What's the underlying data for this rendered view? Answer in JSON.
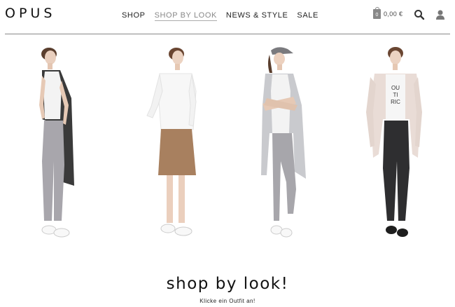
{
  "brand": {
    "logo": "OPUS"
  },
  "nav": {
    "items": [
      {
        "label": "SHOP",
        "active": false
      },
      {
        "label": "SHOP BY LOOK",
        "active": true
      },
      {
        "label": "NEWS & STYLE",
        "active": false
      },
      {
        "label": "SALE",
        "active": false
      }
    ]
  },
  "cart": {
    "count": "0",
    "total": "0,00 €"
  },
  "icons": {
    "search": "search-icon",
    "account": "user-icon",
    "bag": "shopping-bag-icon"
  },
  "looks": [
    {
      "name": "look-1",
      "top": "white tee, black long vest",
      "bottom": "grey trousers",
      "shoes": "white sneakers"
    },
    {
      "name": "look-2",
      "top": "white sweater",
      "bottom": "tan skirt",
      "shoes": "white sneakers"
    },
    {
      "name": "look-3",
      "top": "white tee, grey vest, cap",
      "bottom": "grey trousers",
      "shoes": "white sneakers"
    },
    {
      "name": "look-4",
      "top": "graphic tee, blush coat",
      "bottom": "black leather pants",
      "shoes": "black loafers"
    }
  ],
  "hero": {
    "title": "shop by look!",
    "subtitle": "Klicke ein Outfit an!"
  }
}
